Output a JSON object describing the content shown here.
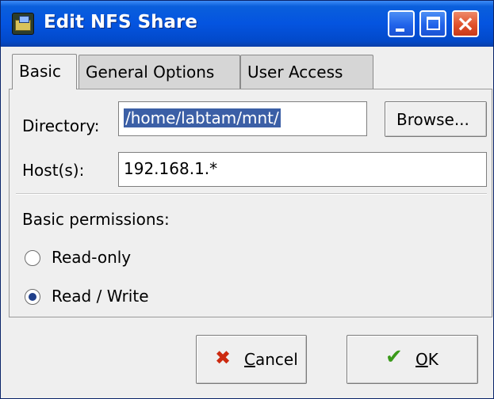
{
  "window": {
    "title": "Edit NFS Share",
    "controls": {
      "minimize": "minimize",
      "maximize": "maximize",
      "close": "close"
    }
  },
  "tabs": [
    {
      "label": "Basic",
      "active": true
    },
    {
      "label": "General Options",
      "active": false
    },
    {
      "label": "User Access",
      "active": false
    }
  ],
  "form": {
    "directory_label": "Directory:",
    "directory_value": "/home/labtam/mnt/",
    "browse_label": "Browse...",
    "hosts_label": "Host(s):",
    "hosts_value": "192.168.1.*",
    "permissions_heading": "Basic permissions:",
    "options": [
      {
        "label": "Read-only",
        "selected": false
      },
      {
        "label": "Read / Write",
        "selected": true
      }
    ]
  },
  "buttons": {
    "cancel": {
      "mnemonic": "C",
      "rest": "ancel",
      "icon": "cancel-x-icon"
    },
    "ok": {
      "mnemonic": "O",
      "rest": "K",
      "icon": "checkmark-icon"
    }
  },
  "colors": {
    "titlebar": "#0454e0",
    "close_button": "#e0512b",
    "selection": "#3b5fa6",
    "cancel_icon": "#cc2a10",
    "ok_icon": "#3a9a1a"
  }
}
